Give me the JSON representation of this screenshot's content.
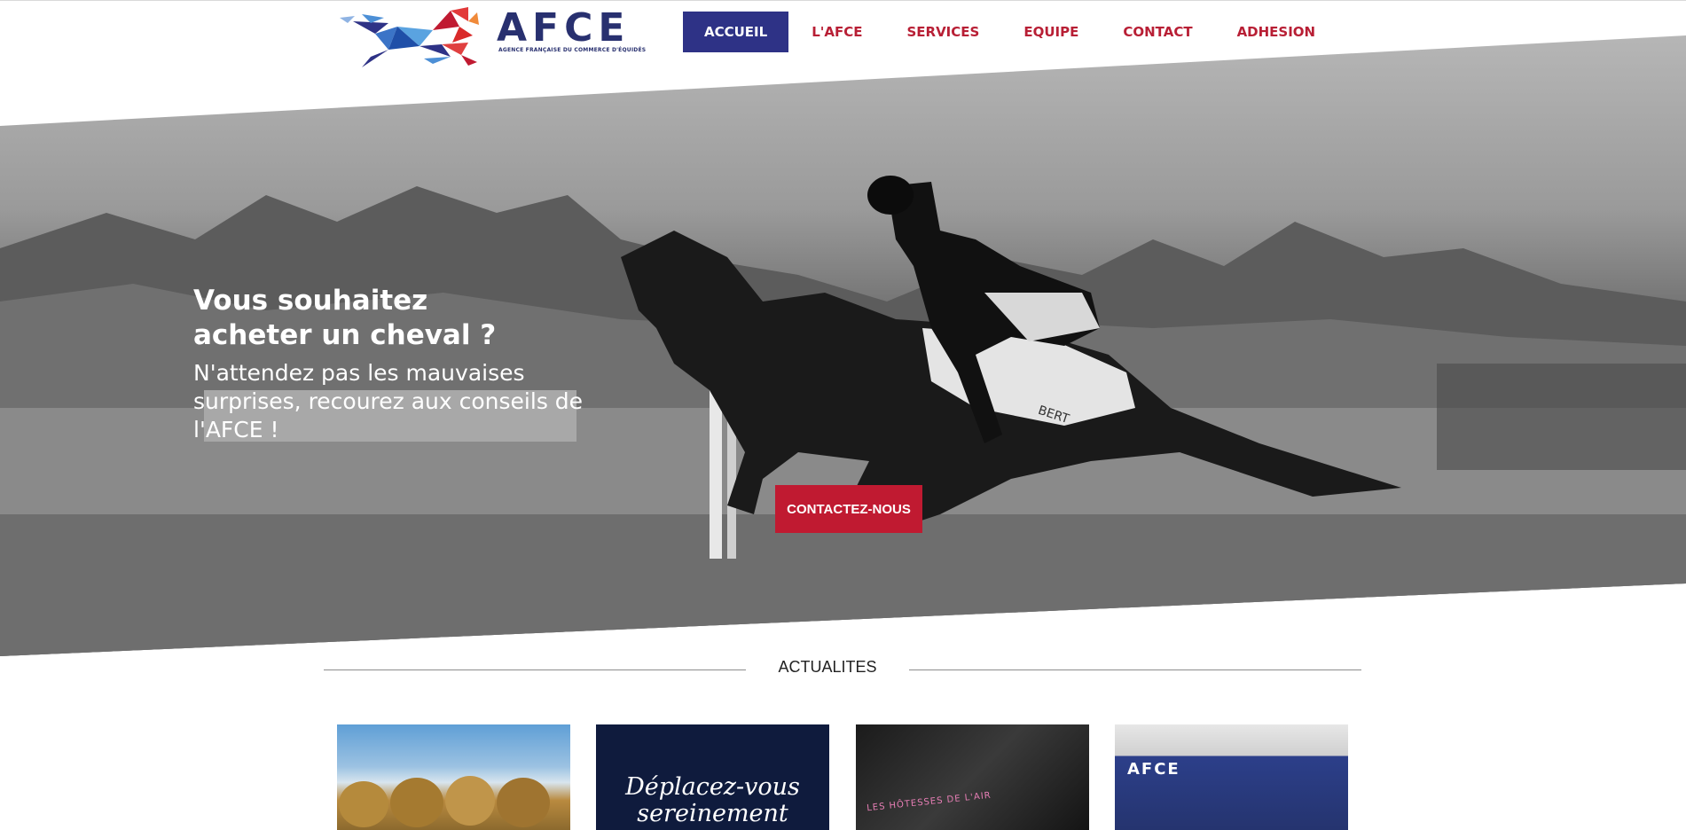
{
  "header": {
    "logo_text": "AFCE",
    "logo_subtitle": "AGENCE FRANÇAISE DU COMMERCE D'ÉQUIDÉS",
    "nav": [
      {
        "label": "ACCUEIL",
        "active": true
      },
      {
        "label": "L'AFCE"
      },
      {
        "label": "SERVICES"
      },
      {
        "label": "EQUIPE"
      },
      {
        "label": "CONTACT"
      },
      {
        "label": "ADHESION"
      }
    ]
  },
  "hero": {
    "title_line1": "Vous souhaitez",
    "title_line2": "acheter un cheval ?",
    "text": "N'attendez pas les mauvaises surprises, recourez aux conseils de l'AFCE !",
    "cta_label": "CONTACTEZ-NOUS",
    "saddle_pad_text": "BERT"
  },
  "news": {
    "section_title": "ACTUALITES",
    "cards": [
      {
        "text": ""
      },
      {
        "text": "Déplacez-vous sereinement"
      },
      {
        "text": "LES HÔTESSES DE L'AIR"
      },
      {
        "text": "AFCE"
      }
    ]
  },
  "colors": {
    "brand_navy": "#2e3286",
    "brand_red": "#b81f35",
    "cta_red": "#c01a31"
  }
}
